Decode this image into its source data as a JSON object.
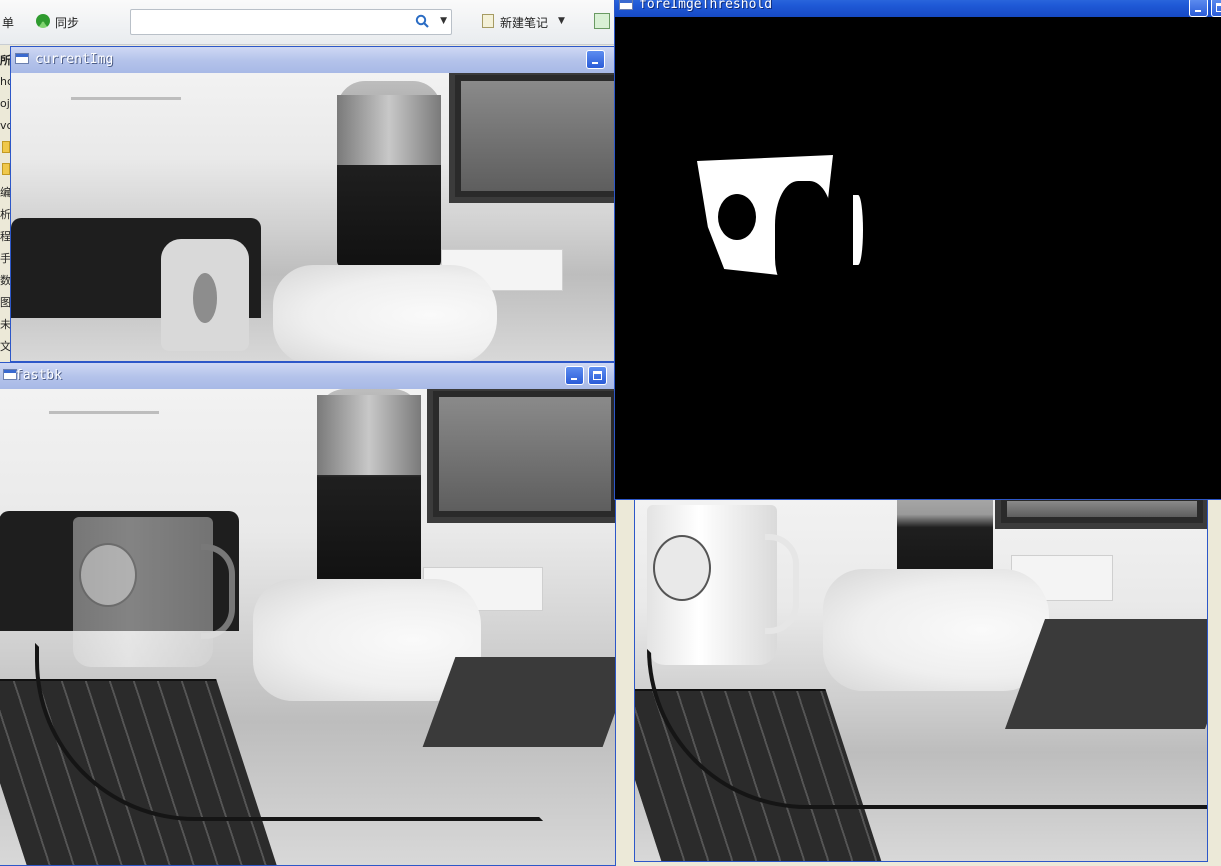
{
  "toolbar": {
    "menu_label": "单",
    "sync_label": "同步",
    "search_placeholder": "",
    "new_note_label": "新建笔记"
  },
  "sidebar_fragments": [
    "编",
    "析",
    "程",
    "手",
    "数",
    "图",
    "未",
    "文"
  ],
  "sidebar_fragments_latin": [
    "所",
    "hc",
    "oj",
    "vc"
  ],
  "windows": {
    "current": {
      "title": "currentImg"
    },
    "fastbk": {
      "title": "fastbk"
    },
    "threshold": {
      "title": "foreImgeThreshold"
    }
  },
  "colors": {
    "xp_blue": "#2d57c8",
    "threshold_bg": "#000000"
  }
}
